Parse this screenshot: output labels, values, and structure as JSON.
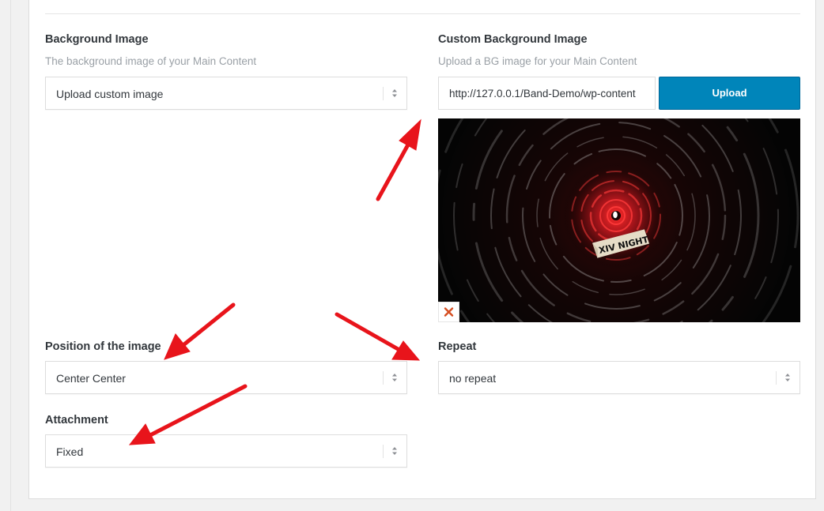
{
  "background_image": {
    "label": "Background Image",
    "description": "The background image of your Main Content",
    "selected": "Upload custom image"
  },
  "custom_background": {
    "label": "Custom Background Image",
    "description": "Upload a BG image for your Main Content",
    "url_value": "http://127.0.0.1/Band-Demo/wp-content",
    "upload_label": "Upload",
    "preview_text": "XIV NIGHT",
    "remove_icon": "close-icon"
  },
  "position": {
    "label": "Position of the image",
    "selected": "Center Center"
  },
  "repeat": {
    "label": "Repeat",
    "selected": "no repeat"
  },
  "attachment": {
    "label": "Attachment",
    "selected": "Fixed"
  },
  "colors": {
    "accent": "#0085ba",
    "annotation_arrow": "#e8141b",
    "remove_icon": "#d54e21"
  },
  "icons": {
    "select_arrows": "updown-arrows-icon"
  }
}
